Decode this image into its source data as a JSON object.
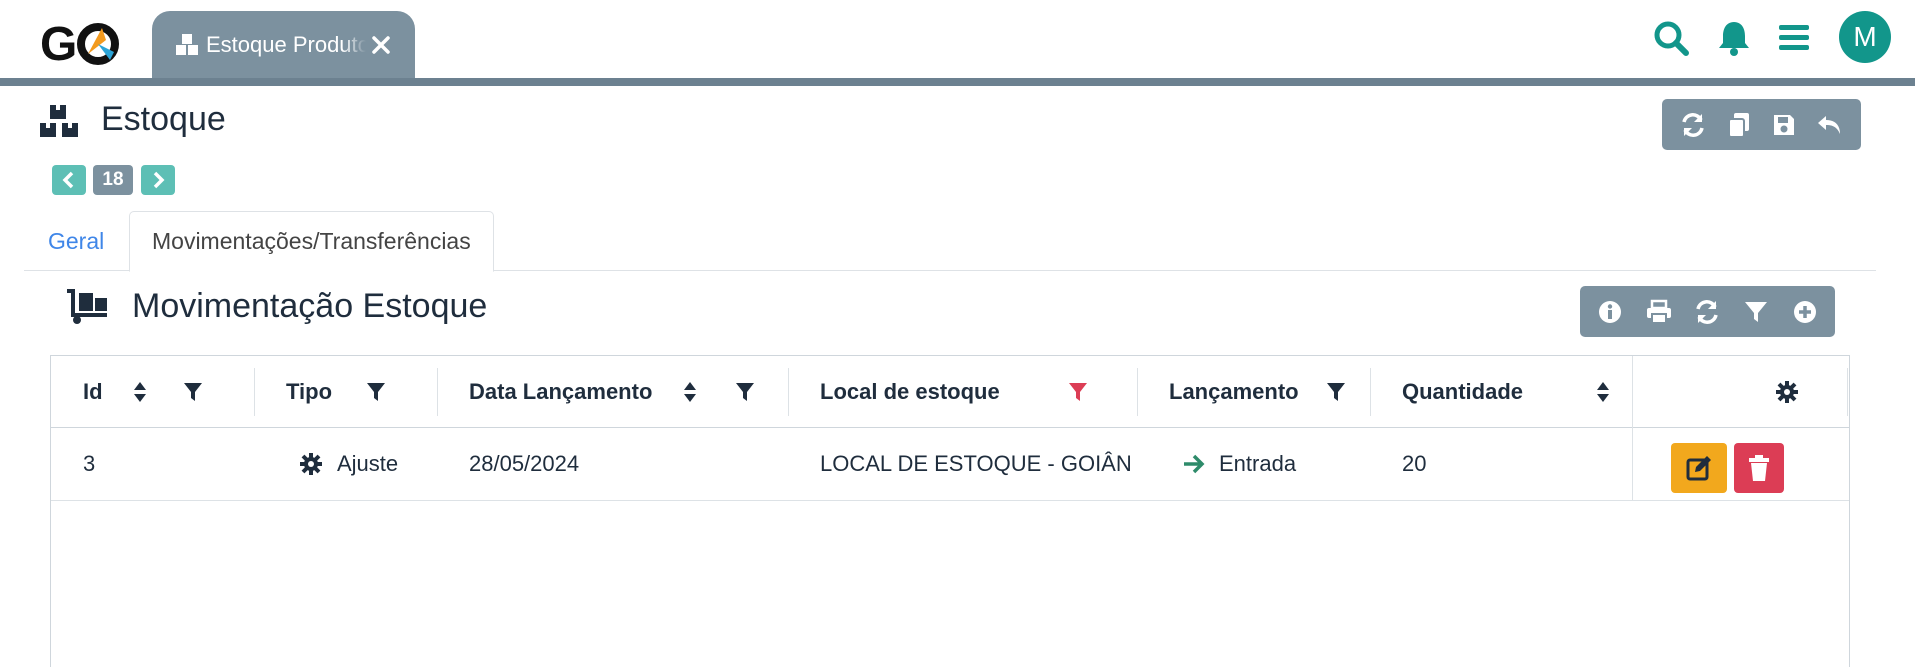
{
  "topbar": {
    "logo_text": "GO",
    "tab_label": "Estoque Produto",
    "avatar_letter": "M",
    "icons": [
      "search-icon",
      "bell-icon",
      "menu-icon"
    ]
  },
  "page": {
    "title": "Estoque",
    "record_number": "18"
  },
  "tabs": [
    {
      "label": "Geral",
      "active": false
    },
    {
      "label": "Movimentações/Transferências",
      "active": true
    }
  ],
  "section": {
    "title": "Movimentação Estoque"
  },
  "table": {
    "columns": [
      "Id",
      "Tipo",
      "Data Lançamento",
      "Local de estoque",
      "Lançamento",
      "Quantidade"
    ],
    "rows": [
      {
        "id": "3",
        "tipo": "Ajuste",
        "data": "28/05/2024",
        "local": "LOCAL DE ESTOQUE - GOIÂN",
        "lancamento": "Entrada",
        "quantidade": "20"
      }
    ]
  },
  "colors": {
    "teal": "#12968b",
    "slate": "#7c919f",
    "edit": "#f2a81d",
    "delete": "#dc3d55",
    "active_filter": "#dc3d55",
    "link": "#3f86e8"
  }
}
